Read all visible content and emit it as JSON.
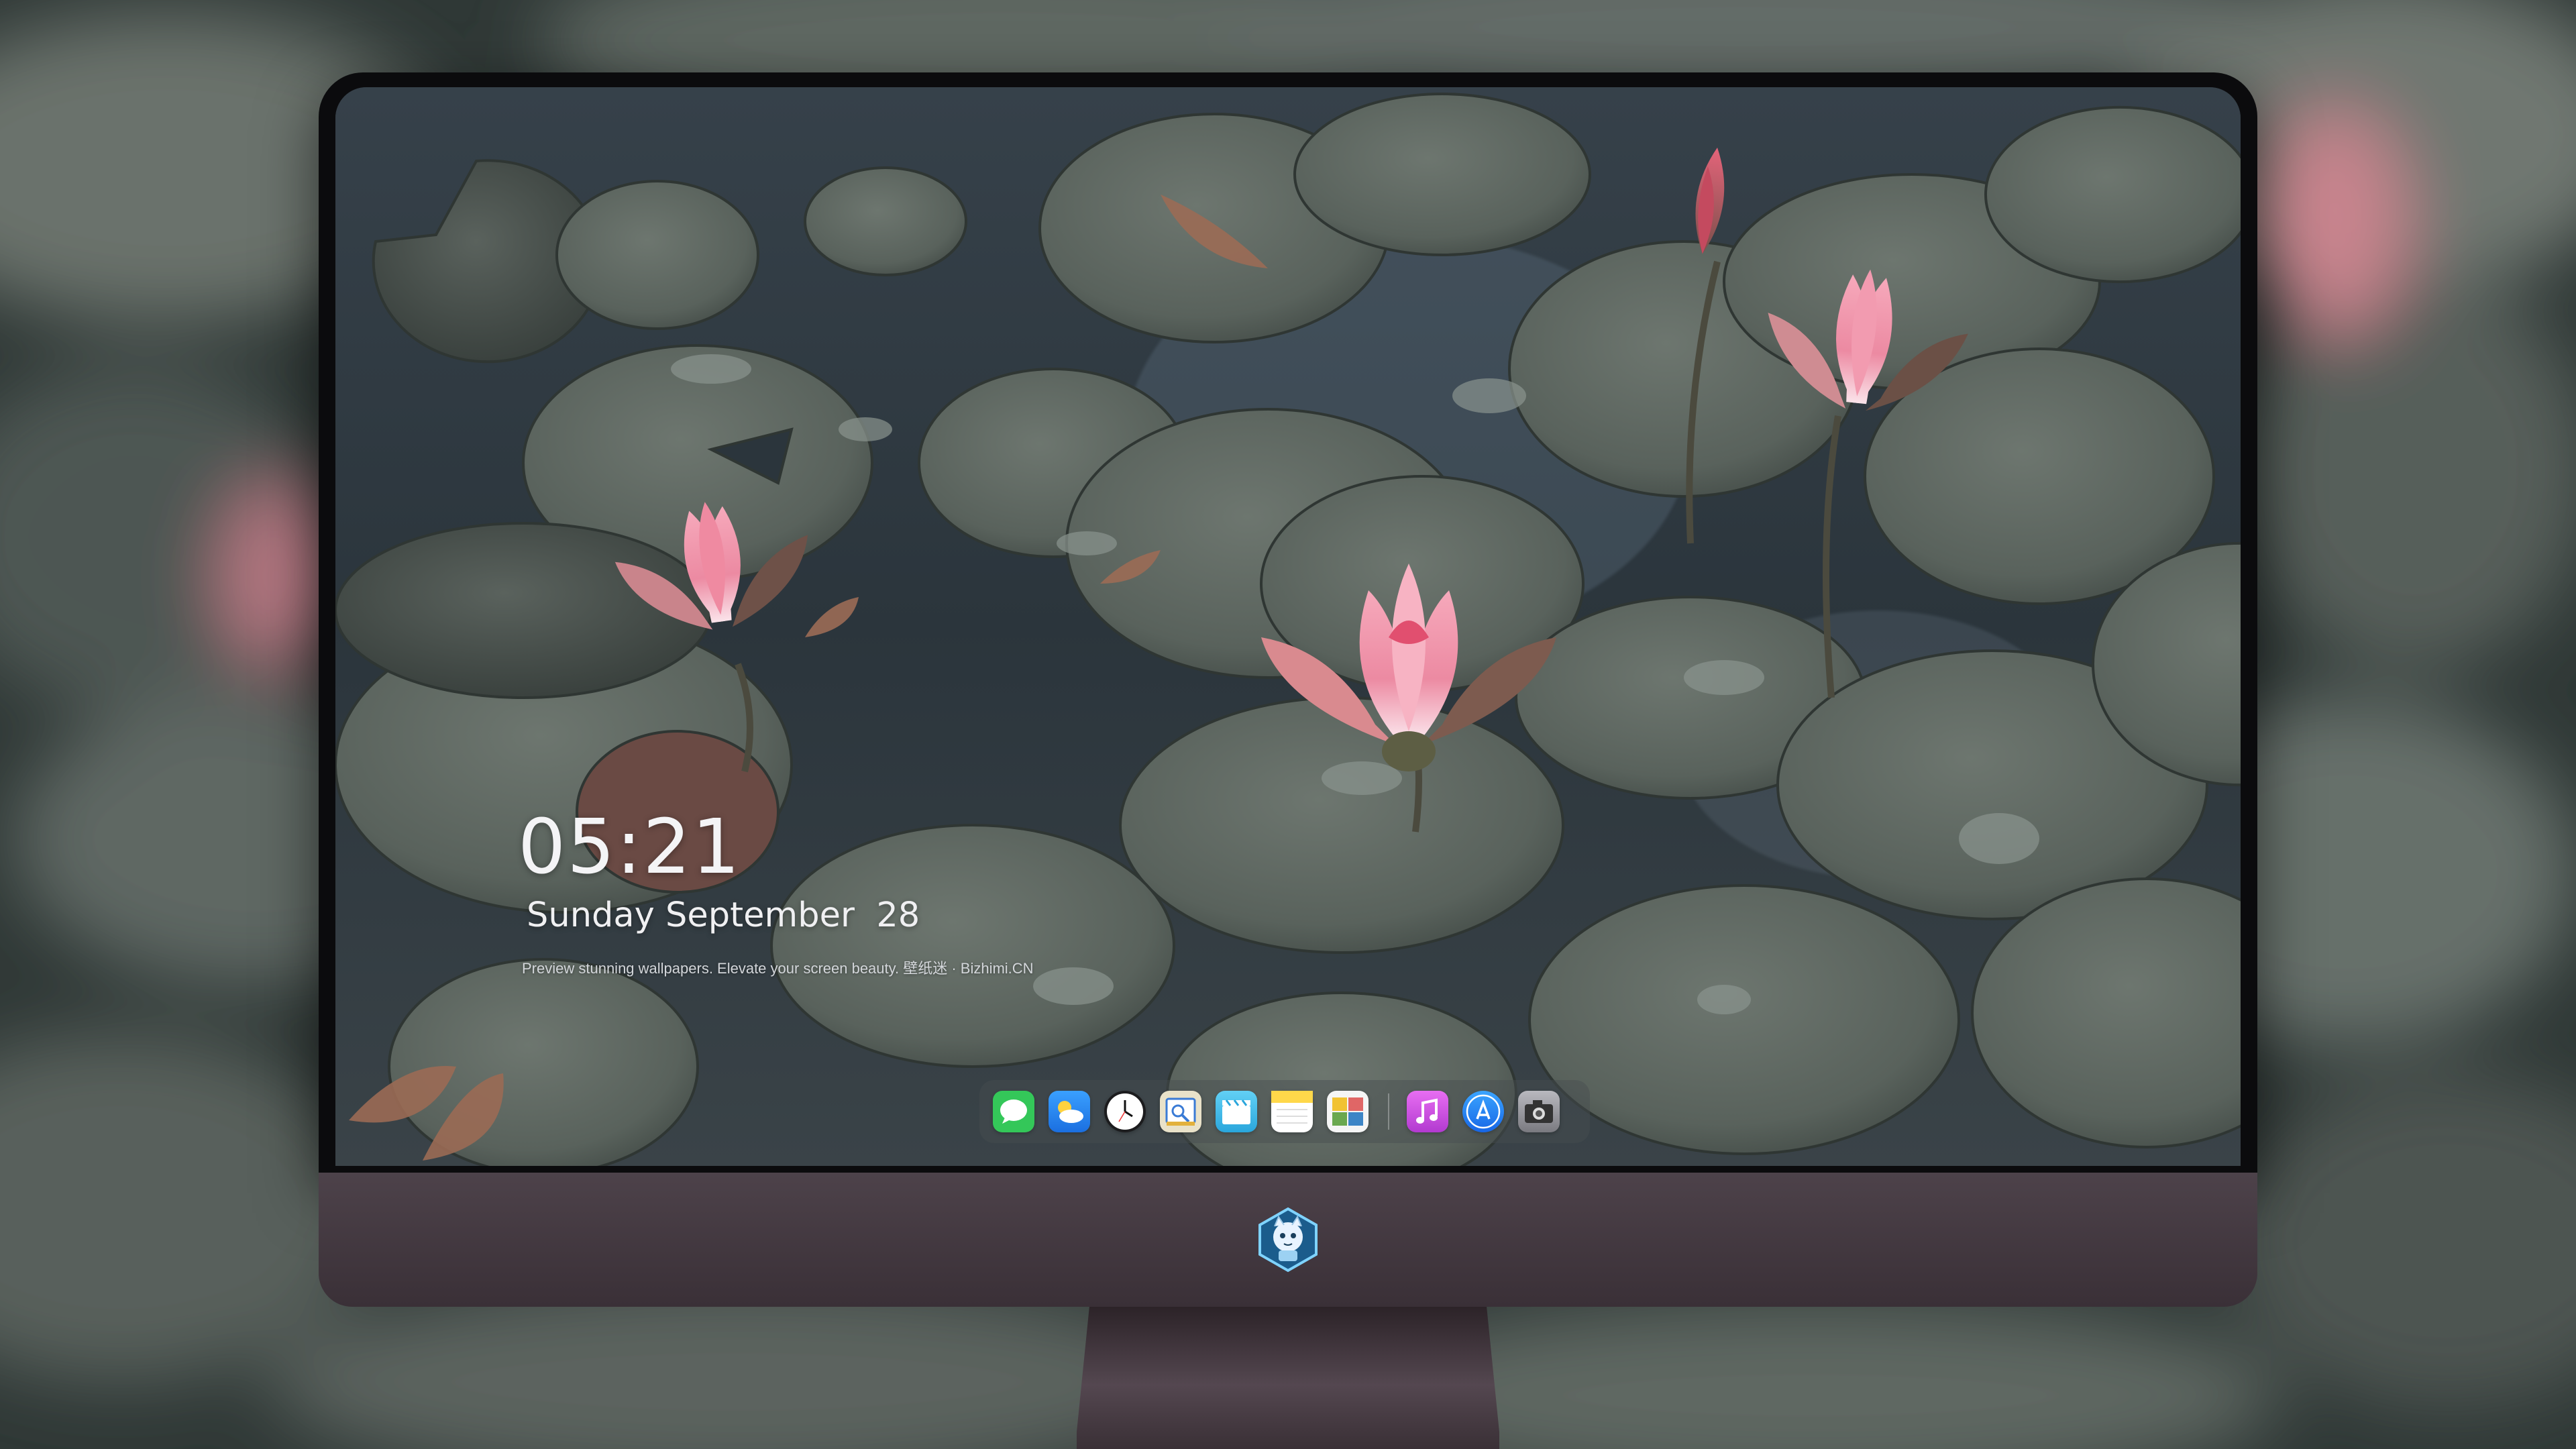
{
  "lockscreen": {
    "time": "05:21",
    "date": "Sunday September  28",
    "tagline": "Preview stunning wallpapers. Elevate your screen beauty. 壁纸迷 · Bizhimi.CN"
  },
  "dock": {
    "apps": [
      {
        "icon": "messages-icon",
        "color": "#34c759"
      },
      {
        "icon": "weather-icon",
        "color": "#2f8cf5"
      },
      {
        "icon": "clock-icon",
        "color": "#1c1c1e"
      },
      {
        "icon": "preview-icon",
        "color": "#e9e2c9"
      },
      {
        "icon": "clips-icon",
        "color": "#4ec6f0"
      },
      {
        "icon": "notes-icon",
        "color": "#ffd84a"
      },
      {
        "icon": "photo-booth-icon",
        "color": "#f5f5f5"
      },
      {
        "icon": "music-icon",
        "color": "#d14ee2"
      },
      {
        "icon": "app-store-icon",
        "color": "#1d8ef5"
      },
      {
        "icon": "camera-icon",
        "color": "#8e8e93"
      }
    ]
  },
  "colors": {
    "bezel": "#0b0b0d",
    "chin": "#4d424a",
    "water": "#2a3438",
    "lily_pad": "#59625c",
    "lotus": "#f29bb0"
  }
}
